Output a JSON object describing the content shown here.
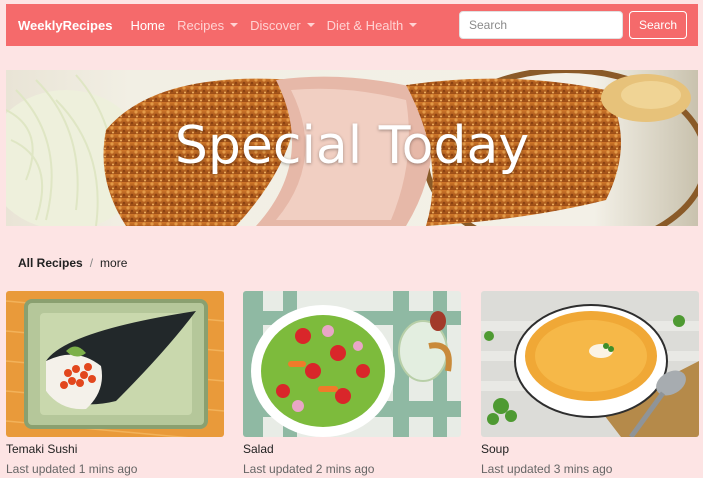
{
  "nav": {
    "brand": "WeeklyRecipes",
    "items": [
      {
        "label": "Home",
        "active": true,
        "dropdown": false
      },
      {
        "label": "Recipes",
        "active": false,
        "dropdown": true
      },
      {
        "label": "Discover",
        "active": false,
        "dropdown": true
      },
      {
        "label": "Diet & Health",
        "active": false,
        "dropdown": true
      }
    ],
    "search_placeholder": "Search",
    "search_button": "Search"
  },
  "hero": {
    "title": "Special Today"
  },
  "breadcrumb": {
    "main": "All Recipes",
    "separator": "/",
    "more": "more"
  },
  "recipes": [
    {
      "title": "Temaki Sushi",
      "meta": "Last updated 1 mins ago"
    },
    {
      "title": "Salad",
      "meta": "Last updated 2 mins ago"
    },
    {
      "title": "Soup",
      "meta": "Last updated 3 mins ago"
    }
  ],
  "colors": {
    "navbar": "#f56a6b",
    "page_background": "#fde4e4"
  }
}
